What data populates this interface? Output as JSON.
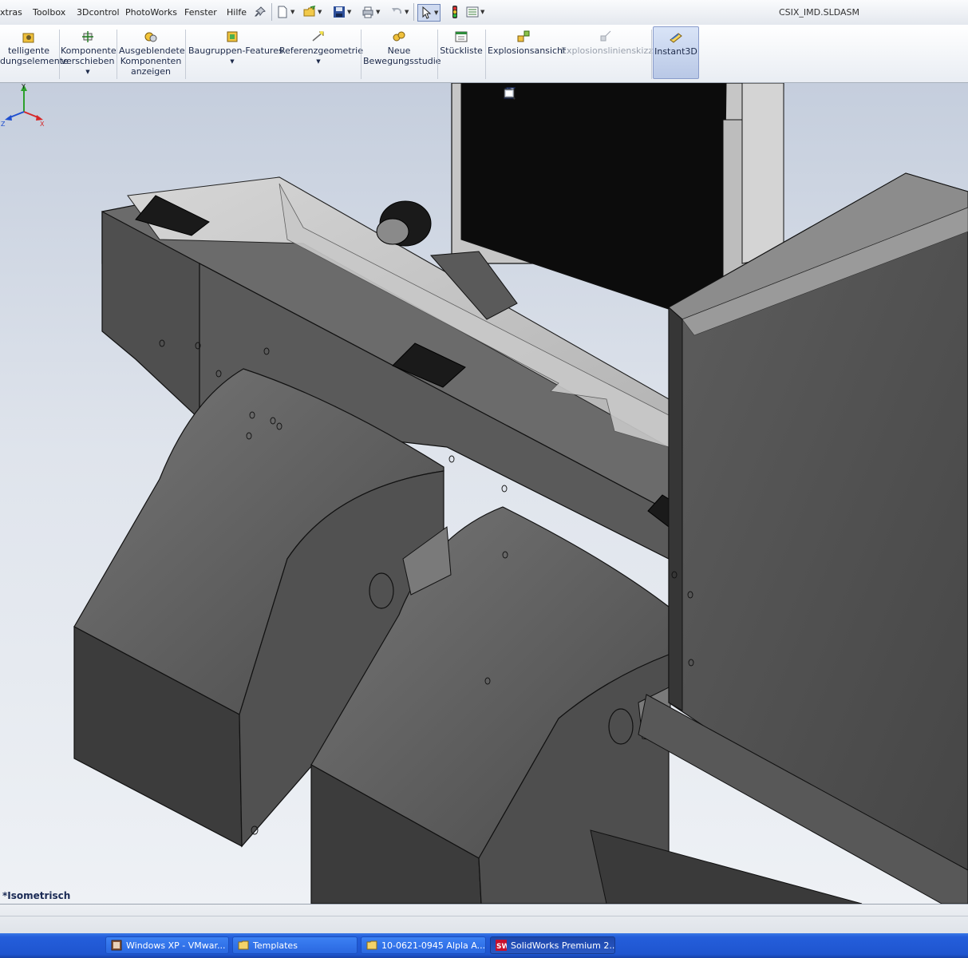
{
  "menubar": {
    "items": [
      "xtras",
      "Toolbox",
      "3Dcontrol",
      "PhotoWorks",
      "Fenster",
      "Hilfe"
    ],
    "document_title": "CSIX_IMD.SLDASM"
  },
  "commands": [
    {
      "label": "telligente\ndungselemente",
      "icon": "smart-fasteners-icon",
      "enabled": true
    },
    {
      "label": "Komponente\nverschieben",
      "icon": "move-component-icon",
      "enabled": true,
      "dropdown": true
    },
    {
      "label": "Ausgeblendete\nKomponenten\nanzeigen",
      "icon": "show-hidden-components-icon",
      "enabled": true
    },
    {
      "label": "Baugruppen-Features",
      "icon": "assembly-features-icon",
      "enabled": true,
      "dropdown": true
    },
    {
      "label": "Referenzgeometrie",
      "icon": "reference-geometry-icon",
      "enabled": true,
      "dropdown": true
    },
    {
      "label": "Neue\nBewegungsstudie",
      "icon": "new-motion-study-icon",
      "enabled": true
    },
    {
      "label": "Stückliste",
      "icon": "bill-of-materials-icon",
      "enabled": true
    },
    {
      "label": "Explosionsansicht",
      "icon": "exploded-view-icon",
      "enabled": true
    },
    {
      "label": "Explosionslinienskizze",
      "icon": "explode-line-sketch-icon",
      "enabled": false
    },
    {
      "label": "Instant3D",
      "icon": "instant3d-icon",
      "enabled": true,
      "active": true
    }
  ],
  "viewport": {
    "view_label": "*Isometrisch",
    "triad": {
      "x": "X",
      "y": "Y",
      "z": "Z"
    }
  },
  "taskbar": {
    "items": [
      {
        "label": "Windows XP - VMwar...",
        "icon": "vmware-icon"
      },
      {
        "label": "Templates",
        "icon": "folder-icon"
      },
      {
        "label": "10-0621-0945 Alpla A...",
        "icon": "folder-icon"
      },
      {
        "label": "SolidWorks Premium 2...",
        "icon": "solidworks-icon",
        "active": true
      }
    ]
  },
  "colors": {
    "taskbar": "#245edb",
    "viewport_top": "#c5cedd",
    "model_dark": "#3b3b3b",
    "model_mid": "#6a6a6a",
    "model_light": "#8c8c8c",
    "active_command": "#b9c8e6"
  }
}
